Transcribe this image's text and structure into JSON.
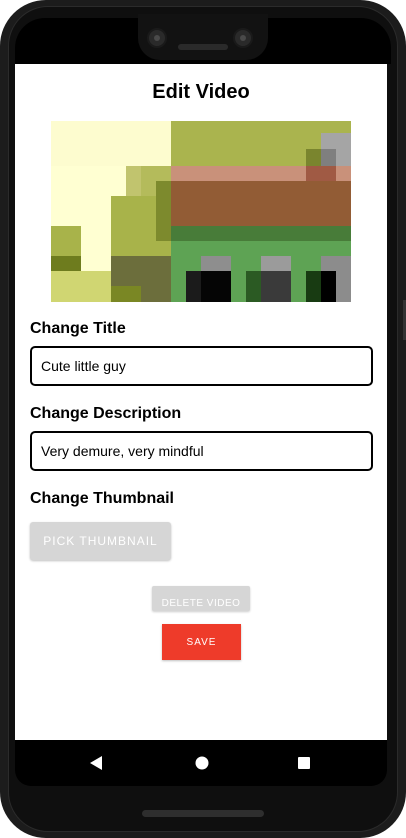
{
  "screen": {
    "title": "Edit Video"
  },
  "thumbnail": {
    "description_icon": "video-thumbnail-image"
  },
  "title_section": {
    "label": "Change Title",
    "value": "Cute little guy"
  },
  "description_section": {
    "label": "Change Description",
    "value": "Very demure, very mindful"
  },
  "thumbnail_section": {
    "label": "Change Thumbnail",
    "pick_label": "PICK THUMBNAIL"
  },
  "actions": {
    "delete_label": "DELETE VIDEO",
    "save_label": "SAVE"
  },
  "nav": {
    "back_icon": "triangle-back-icon",
    "home_icon": "circle-home-icon",
    "recent_icon": "square-recents-icon"
  },
  "colors": {
    "save": "#ee3b2a",
    "disabled": "#d6d6d6"
  }
}
